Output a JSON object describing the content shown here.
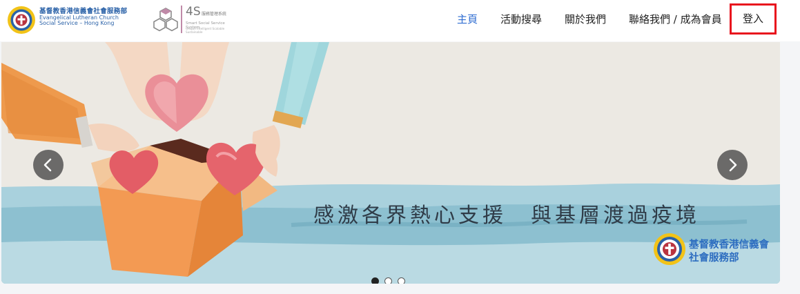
{
  "header": {
    "org_logo": {
      "name_zh": "基督教香港信義會社會服務部",
      "name_en_line1": "Evangelical Lutheran Church",
      "name_en_line2": "Social Service – Hong Kong"
    },
    "system_logo": {
      "mark": "4S",
      "name_zh": "服務管理系統",
      "name_en": "Smart Social Service System",
      "tagline": "Unique Intelligent Scalable Sustainable"
    }
  },
  "nav": {
    "items": [
      {
        "label": "主頁",
        "active": true
      },
      {
        "label": "活動搜尋",
        "active": false
      },
      {
        "label": "關於我們",
        "active": false
      },
      {
        "label": "聯絡我們 / 成為會員",
        "active": false
      }
    ],
    "login_label": "登入",
    "active_color": "#2e6cd1",
    "highlight_color": "#e8121d"
  },
  "carousel": {
    "caption": "感激各界熱心支援　與基層渡過疫境",
    "brand_line1": "基督教香港信義會",
    "brand_line2": "社會服務部",
    "prev_icon": "chevron-left",
    "next_icon": "chevron-right",
    "slide_count": 3,
    "active_slide": 1
  }
}
